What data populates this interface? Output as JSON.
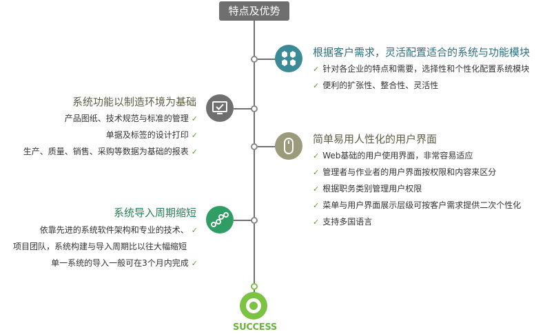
{
  "title": "特点及优势",
  "colors": {
    "line": "#6f6f6f",
    "teal": "#3a8b96",
    "olive": "#9b9b7c",
    "green": "#2e9e64",
    "check": "#5aa02c",
    "success": "#7cc243"
  },
  "check_mark": "✓",
  "sections": {
    "flexible": {
      "heading": "根据客户需求，灵活配置适合的系统与功能模块",
      "icon": "hexagon-cluster-icon",
      "items": [
        "针对各企业的特点和需要，选择性和个性化配置系统模块",
        "便利的扩张性、整合性、灵活性"
      ]
    },
    "manufacturing": {
      "heading": "系统功能以制造环境为基础",
      "icon": "monitor-check-icon",
      "items": [
        "产品图纸、技术规范与标准的管理",
        "单据及标签的设计打印",
        "生产、质量、销售、采购等数据为基础的报表"
      ]
    },
    "ui": {
      "heading": "简单易用人性化的用户界面",
      "icon": "mouse-icon",
      "items": [
        "Web基础的用户使用界面，非常容易适应",
        "管理者与作业者的用户界面按权限和内容来区分",
        "根据职务类别管理用户权限",
        "菜单与用户界面展示层级可按客户需求提供二次个性化",
        "支持多国语言"
      ]
    },
    "implementation": {
      "heading": "系统导入周期缩短",
      "icon": "workflow-nodes-icon",
      "items": [
        "依靠先进的系统软件架构和专业的技术、",
        "项目团队，系统构建与导入周期比以往大幅缩短",
        "单一系统的导入一般可在3个月内完成"
      ]
    }
  },
  "success": {
    "label": "SUCCESS",
    "icon": "target-icon"
  }
}
